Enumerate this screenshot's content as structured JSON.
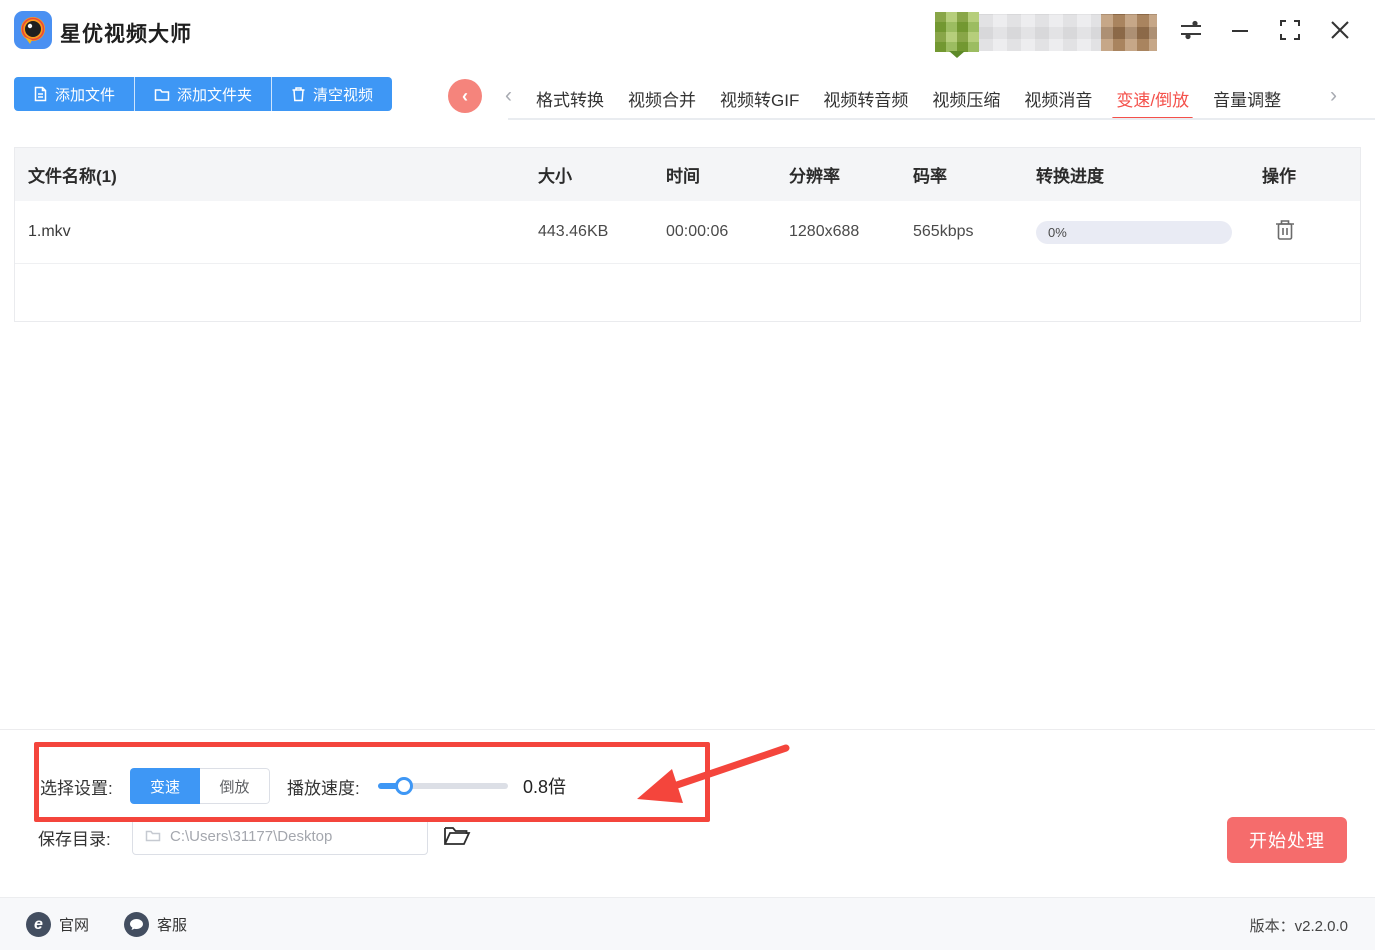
{
  "app": {
    "name": "星优视频大师"
  },
  "toolbar": {
    "add_file": "添加文件",
    "add_folder": "添加文件夹",
    "clear_videos": "清空视频"
  },
  "tabs": {
    "items": [
      "格式转换",
      "视频合并",
      "视频转GIF",
      "视频转音频",
      "视频压缩",
      "视频消音",
      "变速/倒放",
      "音量调整"
    ],
    "active": "变速/倒放",
    "back": "‹",
    "prev": "‹",
    "next": "›"
  },
  "table": {
    "headers": {
      "name": "文件名称(1)",
      "size": "大小",
      "duration": "时间",
      "resolution": "分辨率",
      "bitrate": "码率",
      "progress": "转换进度",
      "actions": "操作"
    },
    "rows": [
      {
        "name": "1.mkv",
        "size": "443.46KB",
        "duration": "00:00:06",
        "resolution": "1280x688",
        "bitrate": "565kbps",
        "progress": "0%"
      }
    ]
  },
  "settings": {
    "label": "选择设置:",
    "mode_speed": "变速",
    "mode_reverse": "倒放",
    "active_mode": "变速",
    "speed_label": "播放速度:",
    "speed_value": "0.8倍"
  },
  "save": {
    "label": "保存目录:",
    "path": "C:\\Users\\31177\\Desktop",
    "start_button": "开始处理"
  },
  "footer": {
    "website": "官网",
    "support": "客服",
    "version": "版本：v2.2.0.0"
  },
  "colors": {
    "primary_blue": "#3E97F5",
    "start_button_red": "#F56C6C",
    "tab_active_red": "#F4504A",
    "annotation_red": "#F4453C"
  }
}
